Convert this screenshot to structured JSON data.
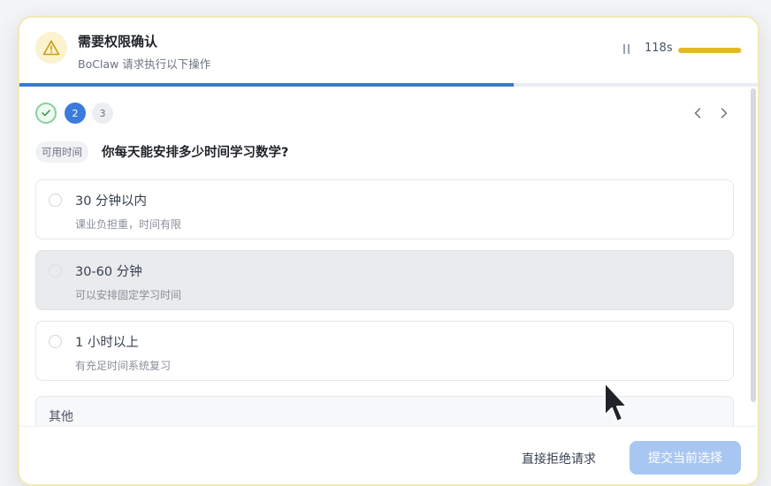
{
  "header": {
    "title": "需要权限确认",
    "subtitle": "BoClaw 请求执行以下操作",
    "timer": "118s",
    "timer_remaining_fraction": 0.98
  },
  "progress": {
    "fraction": 0.67
  },
  "steps": [
    {
      "label": "✓",
      "state": "done"
    },
    {
      "label": "2",
      "state": "current"
    },
    {
      "label": "3",
      "state": "pending"
    }
  ],
  "question": {
    "tag": "可用时间",
    "text": "你每天能安排多少时间学习数学?"
  },
  "options": [
    {
      "label": "30 分钟以内",
      "desc": "课业负担重，时间有限"
    },
    {
      "label": "30-60 分钟",
      "desc": "可以安排固定学习时间"
    },
    {
      "label": "1 小时以上",
      "desc": "有充足时间系统复习"
    }
  ],
  "other_label": "其他",
  "footer": {
    "reject_label": "直接拒绝请求",
    "submit_label": "提交当前选择"
  },
  "colors": {
    "accent": "#3b7bdc",
    "warning": "#e2b826",
    "submit_disabled": "#a8c6f2"
  }
}
